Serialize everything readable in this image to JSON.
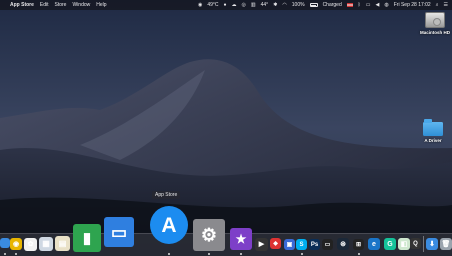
{
  "menubar": {
    "apple": "",
    "app_name": "App Store",
    "menus": [
      "Edit",
      "Store",
      "Window",
      "Help"
    ],
    "status": {
      "temp": "49°C",
      "temp2": "44°",
      "battery_pct": "100%",
      "battery_text": "Charged",
      "datetime": "Fri Sep 28  17:02"
    }
  },
  "desktop": {
    "drive_label": "Macintosh HD",
    "folder_label": "A Driver"
  },
  "tooltip": "App Store",
  "dock": {
    "icons": [
      {
        "name": "finder",
        "glyph": "",
        "color": "#3a8be0"
      },
      {
        "name": "chrome",
        "glyph": "◉",
        "color": "#e8b500"
      },
      {
        "name": "photos",
        "glyph": "✿",
        "color": "#f2f2f2"
      },
      {
        "name": "preview",
        "glyph": "▦",
        "color": "#cfd8e3"
      },
      {
        "name": "contacts",
        "glyph": "▤",
        "color": "#e9e1c7"
      },
      {
        "name": "numbers",
        "glyph": "▮",
        "color": "#2ea44f"
      },
      {
        "name": "keynote",
        "glyph": "▭",
        "color": "#2f7fe0"
      },
      {
        "name": "app-store",
        "glyph": "A",
        "color": "#1c8cf0"
      },
      {
        "name": "system-preferences",
        "glyph": "⚙",
        "color": "#8a8a8e"
      },
      {
        "name": "imovie",
        "glyph": "★",
        "color": "#7d3fc8"
      },
      {
        "name": "final-cut",
        "glyph": "▶",
        "color": "#333"
      },
      {
        "name": "app-red",
        "glyph": "◆",
        "color": "#d33"
      },
      {
        "name": "app-blue",
        "glyph": "▣",
        "color": "#3a6ad6"
      },
      {
        "name": "skype",
        "glyph": "S",
        "color": "#00aff0"
      },
      {
        "name": "photoshop",
        "glyph": "Ps",
        "color": "#0a2e57"
      },
      {
        "name": "app-monitor",
        "glyph": "▭",
        "color": "#222"
      },
      {
        "name": "steam",
        "glyph": "⊛",
        "color": "#1b2838"
      },
      {
        "name": "app-black",
        "glyph": "⊞",
        "color": "#222"
      },
      {
        "name": "edge",
        "glyph": "e",
        "color": "#1a75c8"
      },
      {
        "name": "grammarly",
        "glyph": "G",
        "color": "#15c39a"
      },
      {
        "name": "maps",
        "glyph": "◧",
        "color": "#cfe8cf"
      },
      {
        "name": "quicktime",
        "glyph": "Q",
        "color": "#333"
      },
      {
        "name": "downloads",
        "glyph": "⬇",
        "color": "#3a8be0"
      },
      {
        "name": "trash",
        "glyph": "🗑",
        "color": "#9aa3ad"
      }
    ]
  }
}
